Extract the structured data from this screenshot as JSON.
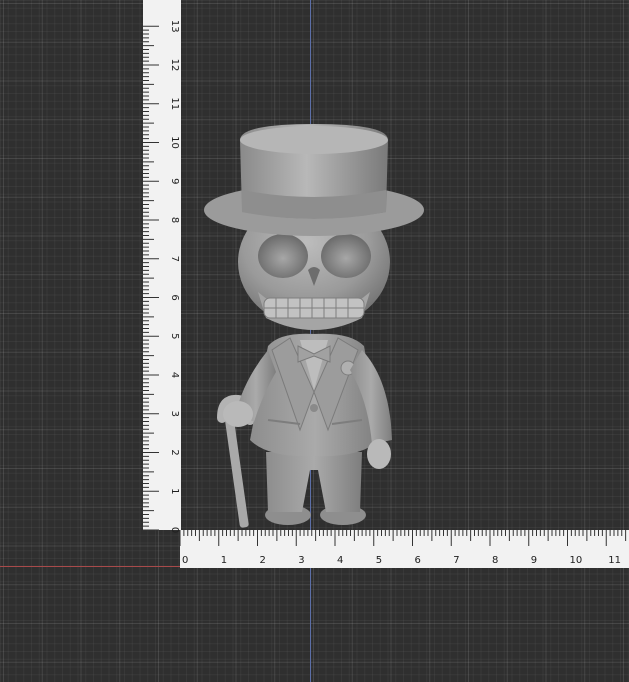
{
  "viewport": {
    "background_color": "#2f2f2f",
    "grid_color": "#4a4a4a",
    "axis_vertical_color": "#5c6fa8",
    "axis_horizontal_color": "#a84a4a"
  },
  "ruler_vertical": {
    "labels": [
      "0",
      "1",
      "2",
      "3",
      "4",
      "5",
      "6",
      "7",
      "8",
      "9",
      "10",
      "11",
      "12",
      "13"
    ]
  },
  "ruler_horizontal": {
    "labels": [
      "0",
      "1",
      "2",
      "3",
      "4",
      "5",
      "6",
      "7",
      "8",
      "9",
      "10",
      "11"
    ]
  },
  "model": {
    "icon": "skeleton-figurine",
    "color": "#9a9a9a"
  }
}
